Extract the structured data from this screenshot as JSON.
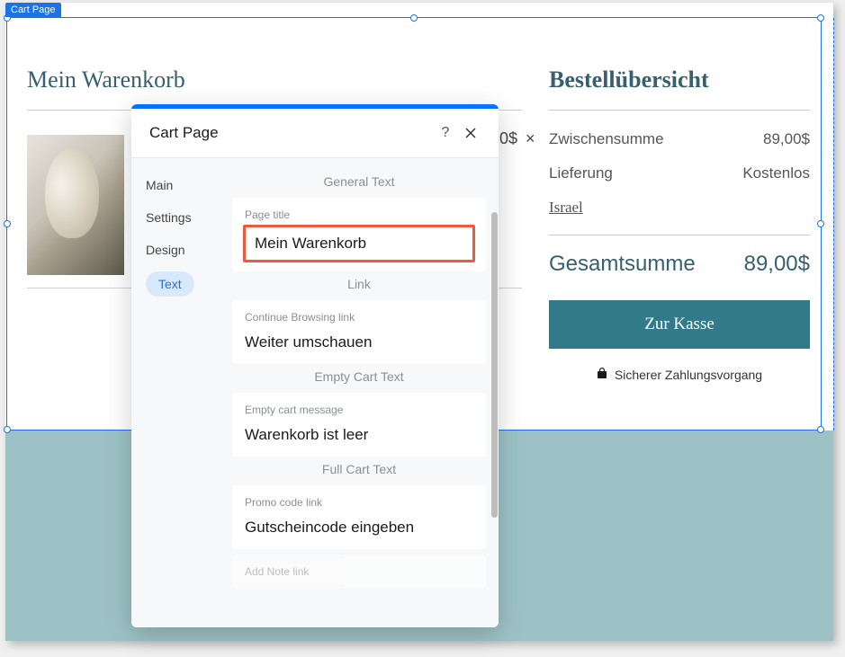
{
  "label_tag": "Cart Page",
  "cart": {
    "title": "Mein Warenkorb",
    "price_fragment": "0$",
    "x_mark": "×"
  },
  "summary": {
    "title": "Bestellübersicht",
    "subtotal_label": "Zwischensumme",
    "subtotal_value": "89,00$",
    "shipping_label": "Lieferung",
    "shipping_value": "Kostenlos",
    "location_link": "Israel",
    "total_label": "Gesamtsumme",
    "total_value": "89,00$",
    "checkout_button": "Zur Kasse",
    "secure_text": "Sicherer Zahlungsvorgang"
  },
  "panel": {
    "title": "Cart Page",
    "tabs": {
      "main": "Main",
      "settings": "Settings",
      "design": "Design",
      "text": "Text"
    },
    "sections": {
      "general_text": "General Text",
      "page_title_label": "Page title",
      "page_title_value": "Mein Warenkorb",
      "link_heading": "Link",
      "continue_label": "Continue Browsing link",
      "continue_value": "Weiter umschauen",
      "empty_heading": "Empty Cart Text",
      "empty_label": "Empty cart message",
      "empty_value": "Warenkorb ist leer",
      "full_heading": "Full Cart Text",
      "promo_label": "Promo code link",
      "promo_value": "Gutscheincode eingeben",
      "addnote_label": "Add Note link"
    }
  }
}
